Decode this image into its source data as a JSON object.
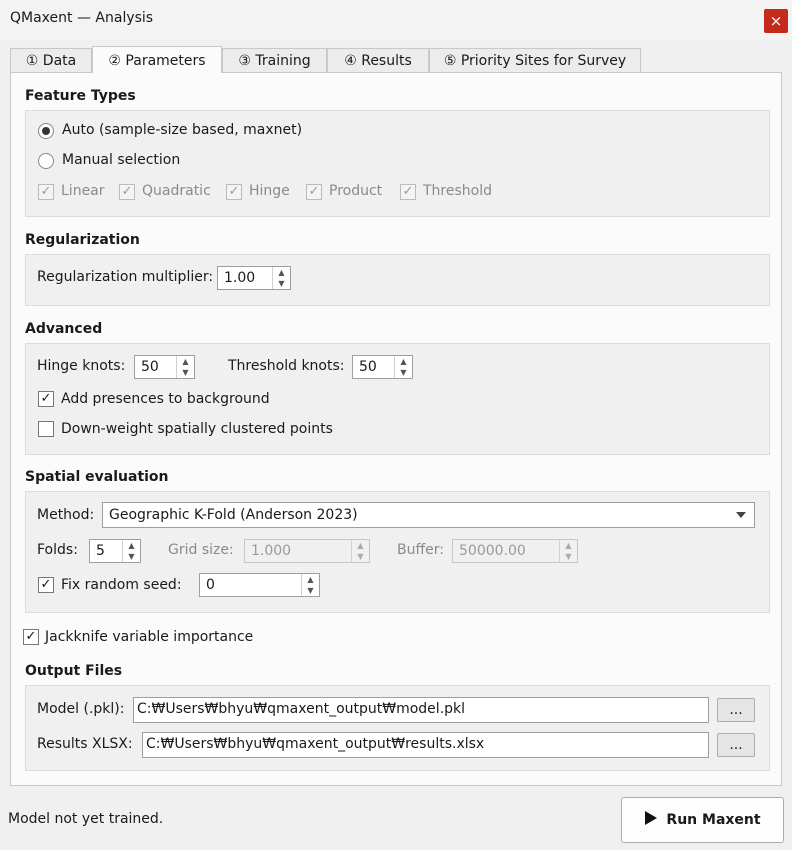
{
  "window": {
    "title": "QMaxent — Analysis",
    "close_glyph": "×"
  },
  "tabs": [
    {
      "label": "① Data"
    },
    {
      "label": "② Parameters"
    },
    {
      "label": "③ Training"
    },
    {
      "label": "④ Results"
    },
    {
      "label": "⑤ Priority Sites for Survey"
    }
  ],
  "feature_types": {
    "title": "Feature Types",
    "auto_label": "Auto (sample-size based, maxnet)",
    "manual_label": "Manual selection",
    "selected_mode": "auto",
    "features": [
      "Linear",
      "Quadratic",
      "Hinge",
      "Product",
      "Threshold"
    ]
  },
  "regularization": {
    "title": "Regularization",
    "multiplier_label": "Regularization multiplier:",
    "multiplier_value": "1.00"
  },
  "advanced": {
    "title": "Advanced",
    "hinge_label": "Hinge knots:",
    "hinge_value": "50",
    "threshold_label": "Threshold knots:",
    "threshold_value": "50",
    "add_presences_label": "Add presences to background",
    "add_presences_checked": true,
    "downweight_label": "Down-weight spatially clustered points",
    "downweight_checked": false
  },
  "spatial": {
    "title": "Spatial evaluation",
    "method_label": "Method:",
    "method_value": "Geographic K-Fold (Anderson 2023)",
    "folds_label": "Folds:",
    "folds_value": "5",
    "grid_label": "Grid size:",
    "grid_value": "1.000",
    "buffer_label": "Buffer:",
    "buffer_value": "50000.00",
    "seed_label": "Fix random seed:",
    "seed_checked": true,
    "seed_value": "0"
  },
  "jackknife": {
    "label": "Jackknife variable importance",
    "checked": true
  },
  "output": {
    "title": "Output Files",
    "model_label": "Model (.pkl):",
    "model_path": "C:₩Users₩bhyu₩qmaxent_output₩model.pkl",
    "results_label": "Results XLSX:",
    "results_path": "C:₩Users₩bhyu₩qmaxent_output₩results.xlsx",
    "browse_label": "..."
  },
  "footer": {
    "status": "Model not yet trained.",
    "run_label": "Run Maxent",
    "run_icon": "play-icon"
  },
  "check_glyph": "✓"
}
